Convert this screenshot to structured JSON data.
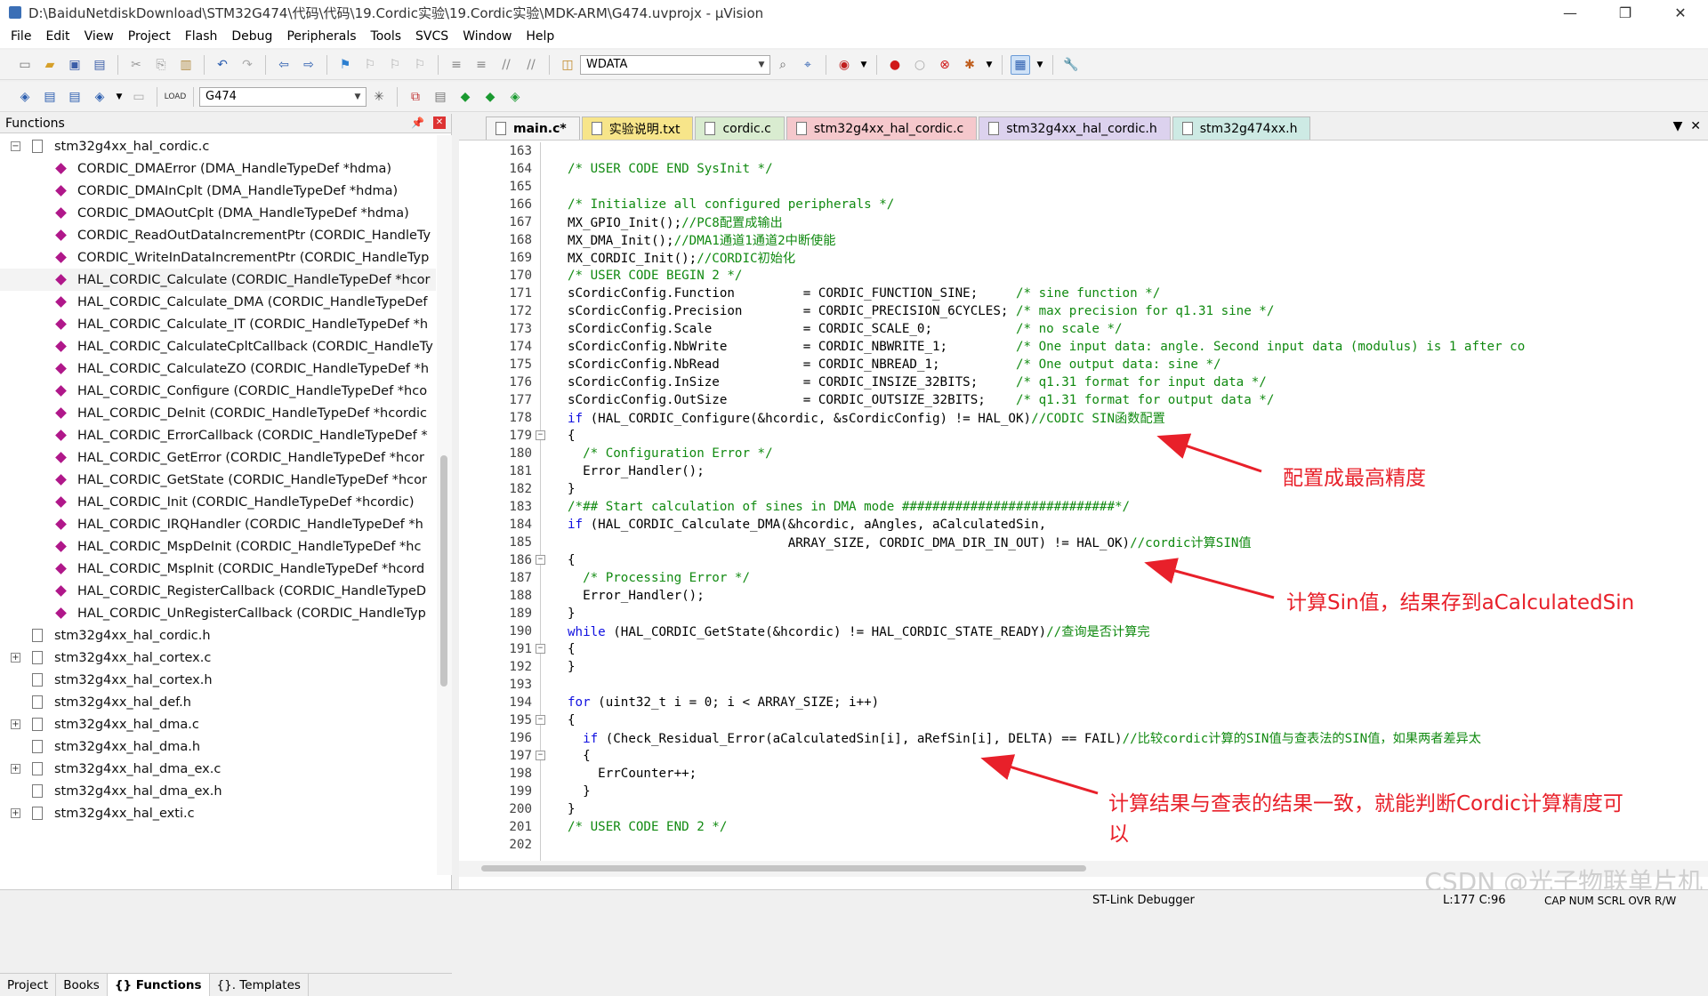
{
  "window": {
    "title": "D:\\BaiduNetdiskDownload\\STM32G474\\代码\\代码\\19.Cordic实验\\19.Cordic实验\\MDK-ARM\\G474.uvprojx - µVision"
  },
  "menu": [
    "File",
    "Edit",
    "View",
    "Project",
    "Flash",
    "Debug",
    "Peripherals",
    "Tools",
    "SVCS",
    "Window",
    "Help"
  ],
  "toolbar1": {
    "find_value": "WDATA"
  },
  "toolbar2": {
    "target_value": "G474"
  },
  "functions_panel": {
    "title": "Functions",
    "items": [
      {
        "type": "file",
        "exp": "−",
        "label": "stm32g4xx_hal_cordic.c"
      },
      {
        "type": "fn",
        "label": "CORDIC_DMAError (DMA_HandleTypeDef *hdma)"
      },
      {
        "type": "fn",
        "label": "CORDIC_DMAInCplt (DMA_HandleTypeDef *hdma)"
      },
      {
        "type": "fn",
        "label": "CORDIC_DMAOutCplt (DMA_HandleTypeDef *hdma)"
      },
      {
        "type": "fn",
        "label": "CORDIC_ReadOutDataIncrementPtr (CORDIC_HandleTy"
      },
      {
        "type": "fn",
        "label": "CORDIC_WriteInDataIncrementPtr (CORDIC_HandleTyp"
      },
      {
        "type": "fn",
        "label": "HAL_CORDIC_Calculate (CORDIC_HandleTypeDef *hcor"
      },
      {
        "type": "fn",
        "label": "HAL_CORDIC_Calculate_DMA (CORDIC_HandleTypeDef"
      },
      {
        "type": "fn",
        "label": "HAL_CORDIC_Calculate_IT (CORDIC_HandleTypeDef *h"
      },
      {
        "type": "fn",
        "label": "HAL_CORDIC_CalculateCpltCallback (CORDIC_HandleTy"
      },
      {
        "type": "fn",
        "label": "HAL_CORDIC_CalculateZO (CORDIC_HandleTypeDef *h"
      },
      {
        "type": "fn",
        "label": "HAL_CORDIC_Configure (CORDIC_HandleTypeDef *hco"
      },
      {
        "type": "fn",
        "label": "HAL_CORDIC_DeInit (CORDIC_HandleTypeDef *hcordic"
      },
      {
        "type": "fn",
        "label": "HAL_CORDIC_ErrorCallback (CORDIC_HandleTypeDef *"
      },
      {
        "type": "fn",
        "label": "HAL_CORDIC_GetError (CORDIC_HandleTypeDef *hcor"
      },
      {
        "type": "fn",
        "label": "HAL_CORDIC_GetState (CORDIC_HandleTypeDef *hcor"
      },
      {
        "type": "fn",
        "label": "HAL_CORDIC_Init (CORDIC_HandleTypeDef *hcordic)"
      },
      {
        "type": "fn",
        "label": "HAL_CORDIC_IRQHandler (CORDIC_HandleTypeDef *h"
      },
      {
        "type": "fn",
        "label": "HAL_CORDIC_MspDeInit (CORDIC_HandleTypeDef *hc"
      },
      {
        "type": "fn",
        "label": "HAL_CORDIC_MspInit (CORDIC_HandleTypeDef *hcord"
      },
      {
        "type": "fn",
        "label": "HAL_CORDIC_RegisterCallback (CORDIC_HandleTypeD"
      },
      {
        "type": "fn",
        "label": "HAL_CORDIC_UnRegisterCallback (CORDIC_HandleTyp"
      },
      {
        "type": "file",
        "exp": "",
        "label": "stm32g4xx_hal_cordic.h"
      },
      {
        "type": "file",
        "exp": "+",
        "label": "stm32g4xx_hal_cortex.c"
      },
      {
        "type": "file",
        "exp": "",
        "label": "stm32g4xx_hal_cortex.h"
      },
      {
        "type": "file",
        "exp": "",
        "label": "stm32g4xx_hal_def.h"
      },
      {
        "type": "file",
        "exp": "+",
        "label": "stm32g4xx_hal_dma.c"
      },
      {
        "type": "file",
        "exp": "",
        "label": "stm32g4xx_hal_dma.h"
      },
      {
        "type": "file",
        "exp": "+",
        "label": "stm32g4xx_hal_dma_ex.c"
      },
      {
        "type": "file",
        "exp": "",
        "label": "stm32g4xx_hal_dma_ex.h"
      },
      {
        "type": "file",
        "exp": "+",
        "label": "stm32g4xx_hal_exti.c"
      }
    ],
    "selected_index": 6,
    "bottom_tabs": [
      "Project",
      "Books",
      "{} Functions",
      "{}. Templates"
    ]
  },
  "editor_tabs": [
    {
      "label": "main.c*",
      "color": "#f4f4f4",
      "bold": true
    },
    {
      "label": "实验说明.txt",
      "color": "#f7e58a",
      "bold": false
    },
    {
      "label": "cordic.c",
      "color": "#d9ecd0",
      "bold": false
    },
    {
      "label": "stm32g4xx_hal_cordic.c",
      "color": "#f5c8cc",
      "bold": false
    },
    {
      "label": "stm32g4xx_hal_cordic.h",
      "color": "#dcd2ee",
      "bold": false
    },
    {
      "label": "stm32g474xx.h",
      "color": "#cdeae4",
      "bold": false
    }
  ],
  "code_lines": [
    {
      "n": "163",
      "f": "",
      "p": []
    },
    {
      "n": "164",
      "f": "",
      "p": [
        [
          "cm",
          "/* USER CODE END SysInit */"
        ]
      ]
    },
    {
      "n": "165",
      "f": "",
      "p": []
    },
    {
      "n": "166",
      "f": "",
      "p": [
        [
          "cm",
          "/* Initialize all configured peripherals */"
        ]
      ]
    },
    {
      "n": "167",
      "f": "",
      "p": [
        [
          "",
          "MX_GPIO_Init();"
        ],
        [
          "cm",
          "//PC8配置成输出"
        ]
      ]
    },
    {
      "n": "168",
      "f": "",
      "p": [
        [
          "",
          "MX_DMA_Init();"
        ],
        [
          "cm",
          "//DMA1通道1通道2中断使能"
        ]
      ]
    },
    {
      "n": "169",
      "f": "",
      "p": [
        [
          "",
          "MX_CORDIC_Init();"
        ],
        [
          "cm",
          "//CORDIC初始化"
        ]
      ]
    },
    {
      "n": "170",
      "f": "",
      "p": [
        [
          "cm",
          "/* USER CODE BEGIN 2 */"
        ]
      ]
    },
    {
      "n": "171",
      "f": "",
      "p": [
        [
          "",
          "sCordicConfig.Function         = CORDIC_FUNCTION_SINE;     "
        ],
        [
          "cm",
          "/* sine function */"
        ]
      ]
    },
    {
      "n": "172",
      "f": "",
      "p": [
        [
          "",
          "sCordicConfig.Precision        = CORDIC_PRECISION_6CYCLES; "
        ],
        [
          "cm",
          "/* max precision for q1.31 sine */"
        ]
      ]
    },
    {
      "n": "173",
      "f": "",
      "p": [
        [
          "",
          "sCordicConfig.Scale            = CORDIC_SCALE_0;           "
        ],
        [
          "cm",
          "/* no scale */"
        ]
      ]
    },
    {
      "n": "174",
      "f": "",
      "p": [
        [
          "",
          "sCordicConfig.NbWrite          = CORDIC_NBWRITE_1;         "
        ],
        [
          "cm",
          "/* One input data: angle. Second input data (modulus) is 1 after co"
        ]
      ]
    },
    {
      "n": "175",
      "f": "",
      "p": [
        [
          "",
          "sCordicConfig.NbRead           = CORDIC_NBREAD_1;          "
        ],
        [
          "cm",
          "/* One output data: sine */"
        ]
      ]
    },
    {
      "n": "176",
      "f": "",
      "p": [
        [
          "",
          "sCordicConfig.InSize           = CORDIC_INSIZE_32BITS;     "
        ],
        [
          "cm",
          "/* q1.31 format for input data */"
        ]
      ]
    },
    {
      "n": "177",
      "f": "",
      "p": [
        [
          "",
          "sCordicConfig.OutSize          = CORDIC_OUTSIZE_32BITS;    "
        ],
        [
          "cm",
          "/* q1.31 format for output data */"
        ]
      ]
    },
    {
      "n": "178",
      "f": "",
      "p": [
        [
          "kw",
          "if"
        ],
        [
          "",
          " (HAL_CORDIC_Configure(&hcordic, &sCordicConfig) != HAL_OK)"
        ],
        [
          "cm",
          "//CODIC SIN函数配置"
        ]
      ]
    },
    {
      "n": "179",
      "f": "−",
      "p": [
        [
          "",
          "{"
        ]
      ]
    },
    {
      "n": "180",
      "f": "",
      "p": [
        [
          "",
          "  "
        ],
        [
          "cm",
          "/* Configuration Error */"
        ]
      ]
    },
    {
      "n": "181",
      "f": "",
      "p": [
        [
          "",
          "  Error_Handler();"
        ]
      ]
    },
    {
      "n": "182",
      "f": "",
      "p": [
        [
          "",
          "}"
        ]
      ]
    },
    {
      "n": "183",
      "f": "",
      "p": [
        [
          "cm",
          "/*## Start calculation of sines in DMA mode ############################*/"
        ]
      ]
    },
    {
      "n": "184",
      "f": "",
      "p": [
        [
          "kw",
          "if"
        ],
        [
          "",
          " (HAL_CORDIC_Calculate_DMA(&hcordic, aAngles, aCalculatedSin,"
        ]
      ]
    },
    {
      "n": "185",
      "f": "",
      "p": [
        [
          "",
          "                             ARRAY_SIZE, CORDIC_DMA_DIR_IN_OUT) != HAL_OK)"
        ],
        [
          "cm",
          "//cordic计算SIN值"
        ]
      ]
    },
    {
      "n": "186",
      "f": "−",
      "p": [
        [
          "",
          "{"
        ]
      ]
    },
    {
      "n": "187",
      "f": "",
      "p": [
        [
          "",
          "  "
        ],
        [
          "cm",
          "/* Processing Error */"
        ]
      ]
    },
    {
      "n": "188",
      "f": "",
      "p": [
        [
          "",
          "  Error_Handler();"
        ]
      ]
    },
    {
      "n": "189",
      "f": "",
      "p": [
        [
          "",
          "}"
        ]
      ]
    },
    {
      "n": "190",
      "f": "",
      "p": [
        [
          "kw",
          "while"
        ],
        [
          "",
          " (HAL_CORDIC_GetState(&hcordic) != HAL_CORDIC_STATE_READY)"
        ],
        [
          "cm",
          "//查询是否计算完"
        ]
      ]
    },
    {
      "n": "191",
      "f": "−",
      "p": [
        [
          "",
          "{"
        ]
      ]
    },
    {
      "n": "192",
      "f": "",
      "p": [
        [
          "",
          "}"
        ]
      ]
    },
    {
      "n": "193",
      "f": "",
      "p": []
    },
    {
      "n": "194",
      "f": "",
      "p": [
        [
          "kw",
          "for"
        ],
        [
          "",
          " (uint32_t i = 0; i < ARRAY_SIZE; i++)"
        ]
      ]
    },
    {
      "n": "195",
      "f": "−",
      "p": [
        [
          "",
          "{"
        ]
      ]
    },
    {
      "n": "196",
      "f": "",
      "p": [
        [
          "",
          "  "
        ],
        [
          "kw",
          "if"
        ],
        [
          "",
          " (Check_Residual_Error(aCalculatedSin[i], aRefSin[i], DELTA) == FAIL)"
        ],
        [
          "cm",
          "//比较cordic计算的SIN值与查表法的SIN值，如果两者差异太"
        ]
      ]
    },
    {
      "n": "197",
      "f": "−",
      "p": [
        [
          "",
          "  {"
        ]
      ]
    },
    {
      "n": "198",
      "f": "",
      "p": [
        [
          "",
          "    ErrCounter++;"
        ]
      ]
    },
    {
      "n": "199",
      "f": "",
      "p": [
        [
          "",
          "  }"
        ]
      ]
    },
    {
      "n": "200",
      "f": "",
      "p": [
        [
          "",
          "}"
        ]
      ]
    },
    {
      "n": "201",
      "f": "",
      "p": [
        [
          "cm",
          "/* USER CODE END 2 */"
        ]
      ]
    },
    {
      "n": "202",
      "f": "",
      "p": []
    }
  ],
  "annotations": {
    "a1": "配置成最高精度",
    "a2": "计算Sin值，结果存到aCalculatedSin",
    "a3_line1": "计算结果与查表的结果一致，就能判断Cordic计算精度可",
    "a3_line2": "以"
  },
  "status": {
    "debugger": "ST-Link Debugger",
    "position": "L:177 C:96",
    "flags": "CAP  NUM  SCRL  OVR  R/W"
  },
  "watermark": "CSDN @光子物联单片机",
  "colors": {
    "keyword": "#1010e0",
    "comment": "#118a11",
    "annotation": "#e8202a"
  }
}
